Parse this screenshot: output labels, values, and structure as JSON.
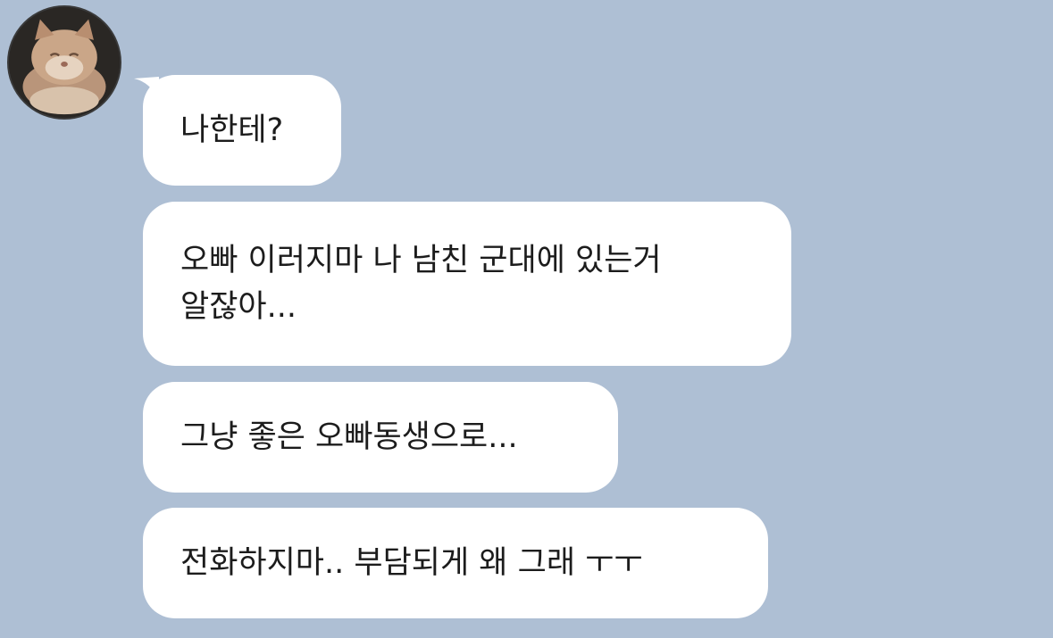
{
  "chat": {
    "bg_color": "#aebfd4",
    "bubble_color": "#ffffff",
    "avatar": {
      "icon": "cat-photo-icon"
    },
    "messages": [
      {
        "lines": [
          "나한테?"
        ]
      },
      {
        "lines": [
          "오빠 이러지마 나 남친 군대에 있는거",
          "알잖아..."
        ]
      },
      {
        "lines": [
          "그냥 좋은 오빠동생으로..."
        ]
      },
      {
        "lines": [
          "전화하지마.. 부담되게 왜 그래 ㅜㅜ"
        ]
      }
    ]
  }
}
